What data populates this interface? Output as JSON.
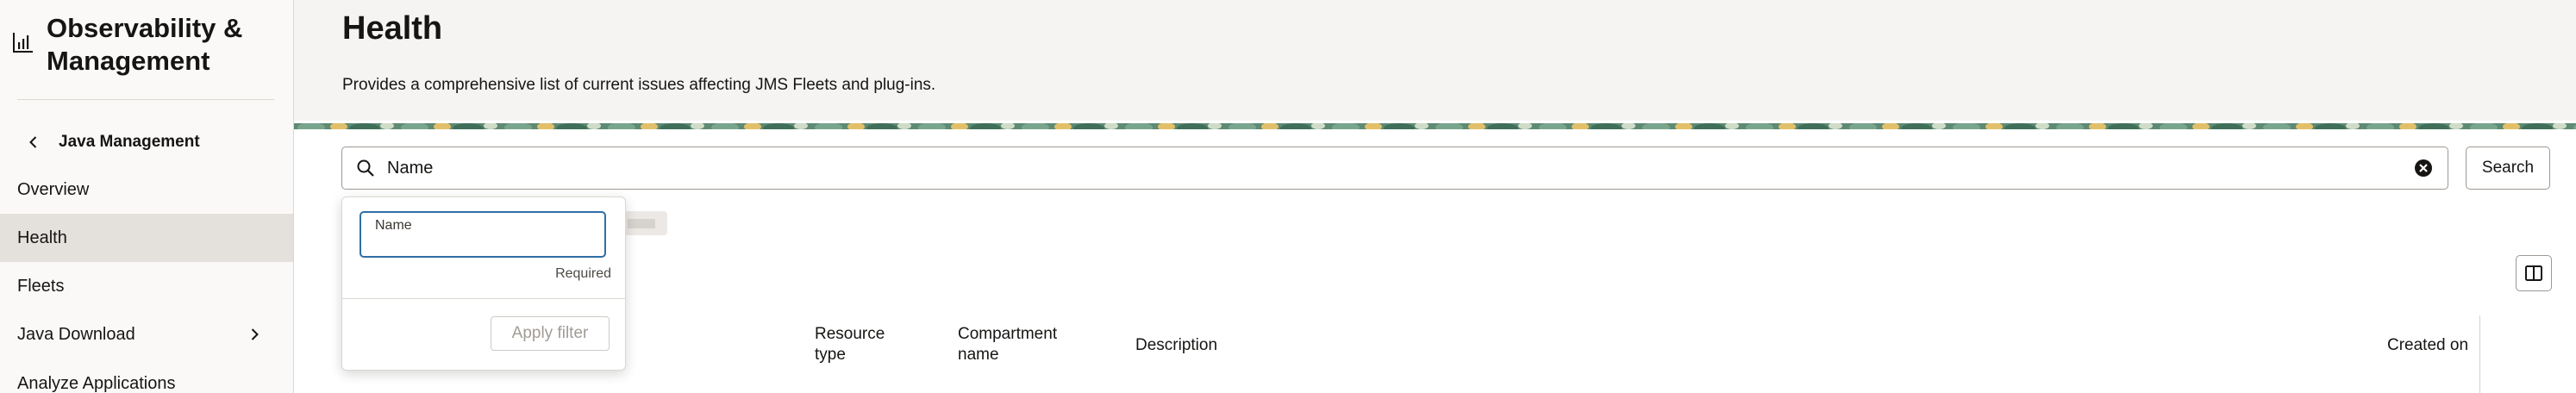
{
  "sidebar": {
    "brand_title": "Observability & Management",
    "back_label": "Java Management",
    "items": [
      {
        "label": "Overview"
      },
      {
        "label": "Health"
      },
      {
        "label": "Fleets"
      },
      {
        "label": "Java Download"
      },
      {
        "label": "Analyze Applications"
      }
    ]
  },
  "header": {
    "title": "Health",
    "description": "Provides a comprehensive list of current issues affecting JMS Fleets and plug-ins."
  },
  "search": {
    "value": "Name",
    "button_label": "Search"
  },
  "filter_popover": {
    "field_label": "Name",
    "field_value": "",
    "required_text": "Required",
    "apply_label": "Apply filter"
  },
  "table": {
    "headers": [
      "Resource type",
      "Compartment name",
      "Description",
      "Created on"
    ]
  },
  "colors": {
    "accent_blue": "#2f6ea5",
    "active_nav": "#e4e1dd",
    "header_bg": "#f5f4f2"
  },
  "icons": [
    "chart-icon",
    "chevron-left-icon",
    "chevron-right-icon",
    "search-icon",
    "clear-icon",
    "columns-icon"
  ]
}
